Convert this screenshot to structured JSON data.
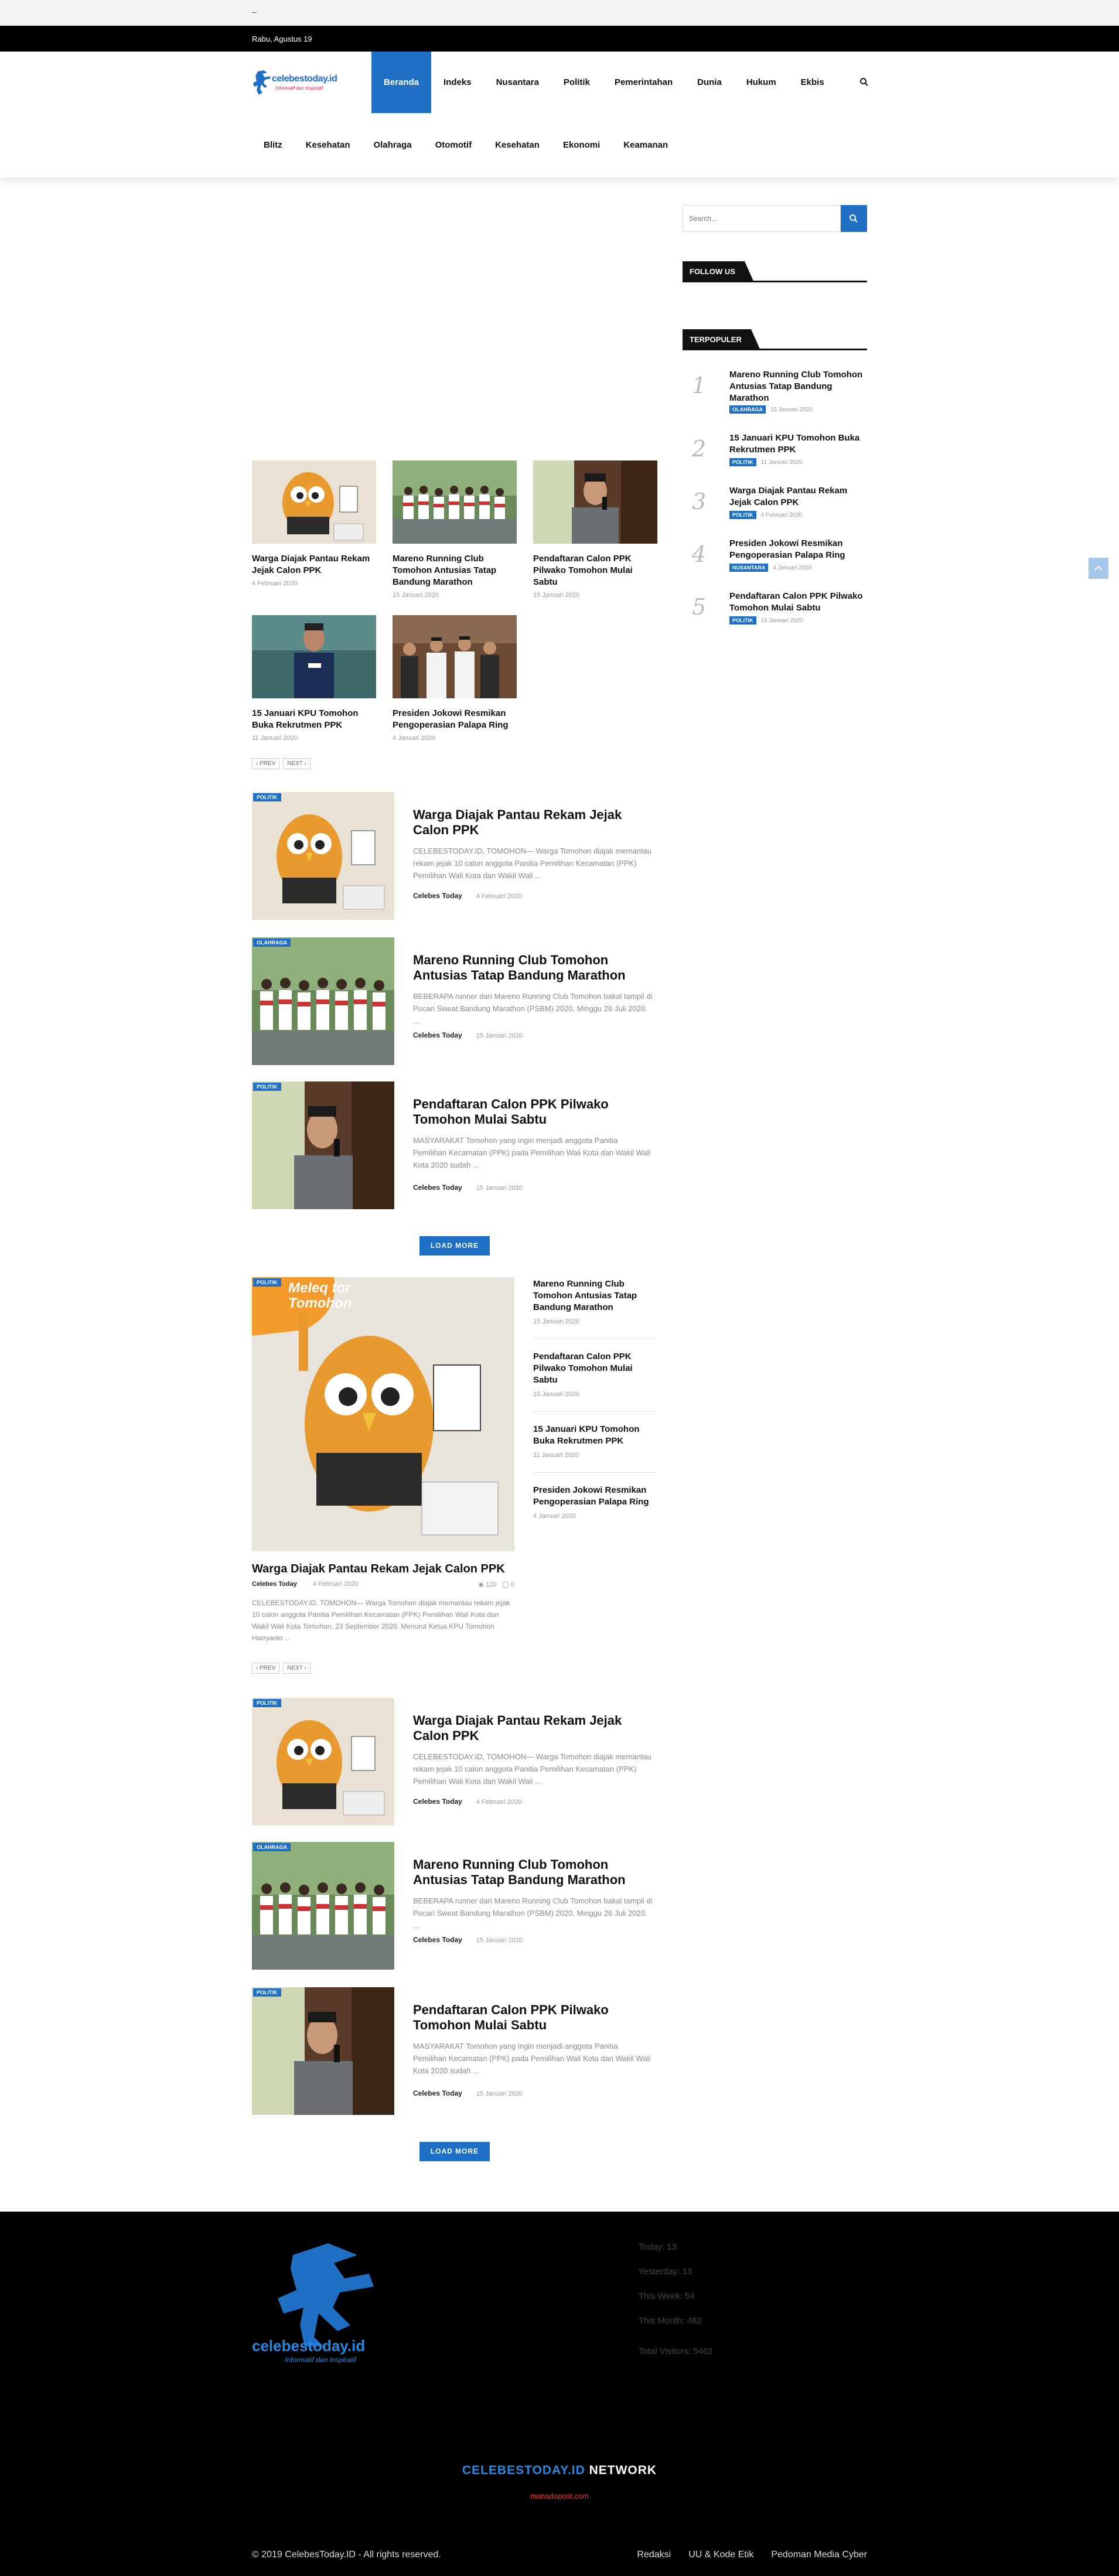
{
  "topbar": {
    "dash": "–"
  },
  "date": "Rabu, Agustus 19",
  "brand": {
    "name": "celebestoday.id",
    "tagline": "Informatif dan Inspiratif",
    "color": "#1f6fc4"
  },
  "nav_primary": [
    "Beranda",
    "Indeks",
    "Nusantara",
    "Politik",
    "Pemerintahan",
    "Dunia",
    "Hukum",
    "Ekbis"
  ],
  "nav_secondary": [
    "Blitz",
    "Kesehatan",
    "Olahraga",
    "Otomotif",
    "Kesehatan",
    "Ekonomi",
    "Keamanan"
  ],
  "search": {
    "placeholder": "Search..."
  },
  "widgets": {
    "follow": "FOLLOW US",
    "popular": "TERPOPULER"
  },
  "popular": [
    {
      "num": "1",
      "title": "Mareno Running Club Tomohon Antusias Tatap Bandung Marathon",
      "cat": "OLAHRAGA",
      "date": "15 Januari 2020"
    },
    {
      "num": "2",
      "title": "15 Januari KPU Tomohon Buka Rekrutmen PPK",
      "cat": "POLITIK",
      "date": "11 Januari 2020"
    },
    {
      "num": "3",
      "title": "Warga Diajak Pantau Rekam Jejak Calon PPK",
      "cat": "POLITIK",
      "date": "4 Februari 2020"
    },
    {
      "num": "4",
      "title": "Presiden Jokowi Resmikan Pengoperasian Palapa Ring",
      "cat": "NUSANTARA",
      "date": "4 Januari 2020"
    },
    {
      "num": "5",
      "title": "Pendaftaran Calon PPK Pilwako Tomohon Mulai Sabtu",
      "cat": "POLITIK",
      "date": "15 Januari 2020"
    }
  ],
  "grid": [
    {
      "title": "Warga Diajak Pantau Rekam Jejak Calon PPK",
      "date": "4 Februari 2020"
    },
    {
      "title": "Mareno Running Club Tomohon Antusias Tatap Bandung Marathon",
      "date": "15 Januari 2020"
    },
    {
      "title": "Pendaftaran Calon PPK Pilwako Tomohon Mulai Sabtu",
      "date": "15 Januari 2020"
    },
    {
      "title": "15 Januari KPU Tomohon Buka Rekrutmen PPK",
      "date": "11 Januari 2020"
    },
    {
      "title": "Presiden Jokowi Resmikan Pengoperasian Palapa Ring",
      "date": "4 Januari 2020"
    }
  ],
  "pager": {
    "prev": "‹ PREV",
    "next": "NEXT ›"
  },
  "posts": [
    {
      "cat": "POLITIK",
      "title": "Warga Diajak Pantau Rekam Jejak Calon PPK",
      "excerpt": "CELEBESTODAY.ID, TOMOHON— Warga Tomohon diajak memantau rekam jejak 10 calon anggota Panitia Pemilihan Kecamatan (PPK) Pemilihan Wali Kota dan Wakil Wali ...",
      "author": "Celebes Today",
      "date": "4 Februari 2020"
    },
    {
      "cat": "OLAHRAGA",
      "title": "Mareno Running Club Tomohon Antusias Tatap Bandung Marathon",
      "excerpt": "BEBERAPA runner dari Mareno Running Club Tomohon bakal tampil di Pocari Sweat Bandung Marathon (PSBM) 2020, Minggu 26 Juli 2020. ...",
      "author": "Celebes Today",
      "date": "15 Januari 2020"
    },
    {
      "cat": "POLITIK",
      "title": "Pendaftaran Calon PPK Pilwako Tomohon Mulai Sabtu",
      "excerpt": "MASYARAKAT Tomohon yang ingin menjadi anggota Panitia Pemilihan Kecamatan (PPK) pada Pemilihan Wali Kota dan Wakil Wali Kota 2020 sudah ...",
      "author": "Celebes Today",
      "date": "15 Januari 2020"
    }
  ],
  "load_more": "LOAD MORE",
  "feature": {
    "cat": "POLITIK",
    "title": "Warga Diajak Pantau Rekam Jejak Calon PPK",
    "author": "Celebes Today",
    "date": "4 Februari 2020",
    "views": "120",
    "comments": "0",
    "excerpt": "CELEBESTODAY.ID, TOMOHON— Warga Tomohon diajak memantau rekam jejak 10 calon anggota Panitia Pemilihan Kecamatan (PPK) Pemilihan Wali Kota dan Wakil Wali Kota Tomohon, 23 September 2020. Menurut Ketua KPU Tomohon Harryanto ...",
    "image_text": "Meleq for Tomohon"
  },
  "feature_side": [
    {
      "title": "Mareno Running Club Tomohon Antusias Tatap Bandung Marathon",
      "date": "15 Januari 2020"
    },
    {
      "title": "Pendaftaran Calon PPK Pilwako Tomohon Mulai Sabtu",
      "date": "15 Januari 2020"
    },
    {
      "title": "15 Januari KPU Tomohon Buka Rekrutmen PPK",
      "date": "11 Januari 2020"
    },
    {
      "title": "Presiden Jokowi Resmikan Pengoperasian Palapa Ring",
      "date": "4 Januari 2020"
    }
  ],
  "footer": {
    "stats": [
      "Today: 13",
      "Yesterday: 13",
      "This Week: 54",
      "This Month: 482",
      "Total Visitors: 5462"
    ],
    "network_prefix": "CELEBESTODAY.ID",
    "network_suffix": " NETWORK",
    "network_link": "manadopost.com",
    "copyright": "© 2019 CelebesToday.ID - All rights reserved.",
    "links": [
      "Redaksi",
      "UU & Kode Etik",
      "Pedoman Media Cyber"
    ]
  }
}
